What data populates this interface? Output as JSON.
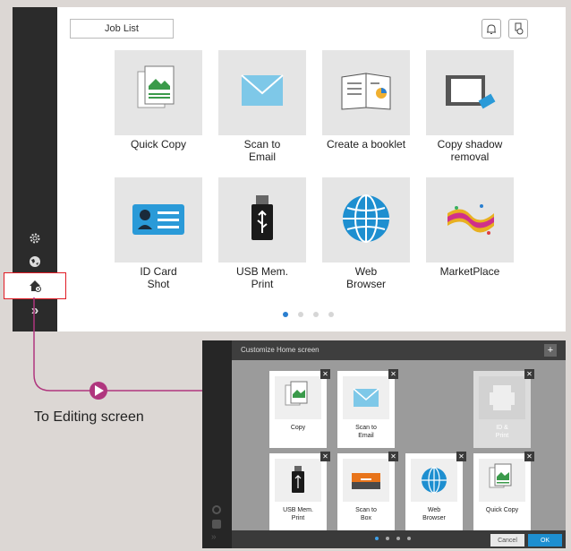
{
  "home": {
    "job_list": "Job List",
    "apps": [
      {
        "label": "Quick Copy"
      },
      {
        "label": "Scan to\nEmail"
      },
      {
        "label": "Create a booklet"
      },
      {
        "label": "Copy shadow\nremoval"
      },
      {
        "label": "ID Card\nShot"
      },
      {
        "label": "USB Mem.\nPrint"
      },
      {
        "label": "Web\nBrowser"
      },
      {
        "label": "MarketPlace"
      }
    ],
    "page_count": 4,
    "current_page": 1
  },
  "callout": {
    "text": "To Editing screen"
  },
  "edit": {
    "title": "Customize Home screen",
    "tiles": [
      {
        "label": "Copy"
      },
      {
        "label": "Scan to\nEmail"
      },
      {
        "label": ""
      },
      {
        "label": "ID &\nPrint"
      },
      {
        "label": "USB Mem.\nPrint"
      },
      {
        "label": "Scan to\nBox"
      },
      {
        "label": "Web\nBrowser"
      },
      {
        "label": "Quick Copy"
      }
    ],
    "cancel": "Cancel",
    "ok": "OK"
  },
  "colors": {
    "accent": "#2a7fd0",
    "highlight": "#e01b24",
    "connector": "#b0367e"
  }
}
